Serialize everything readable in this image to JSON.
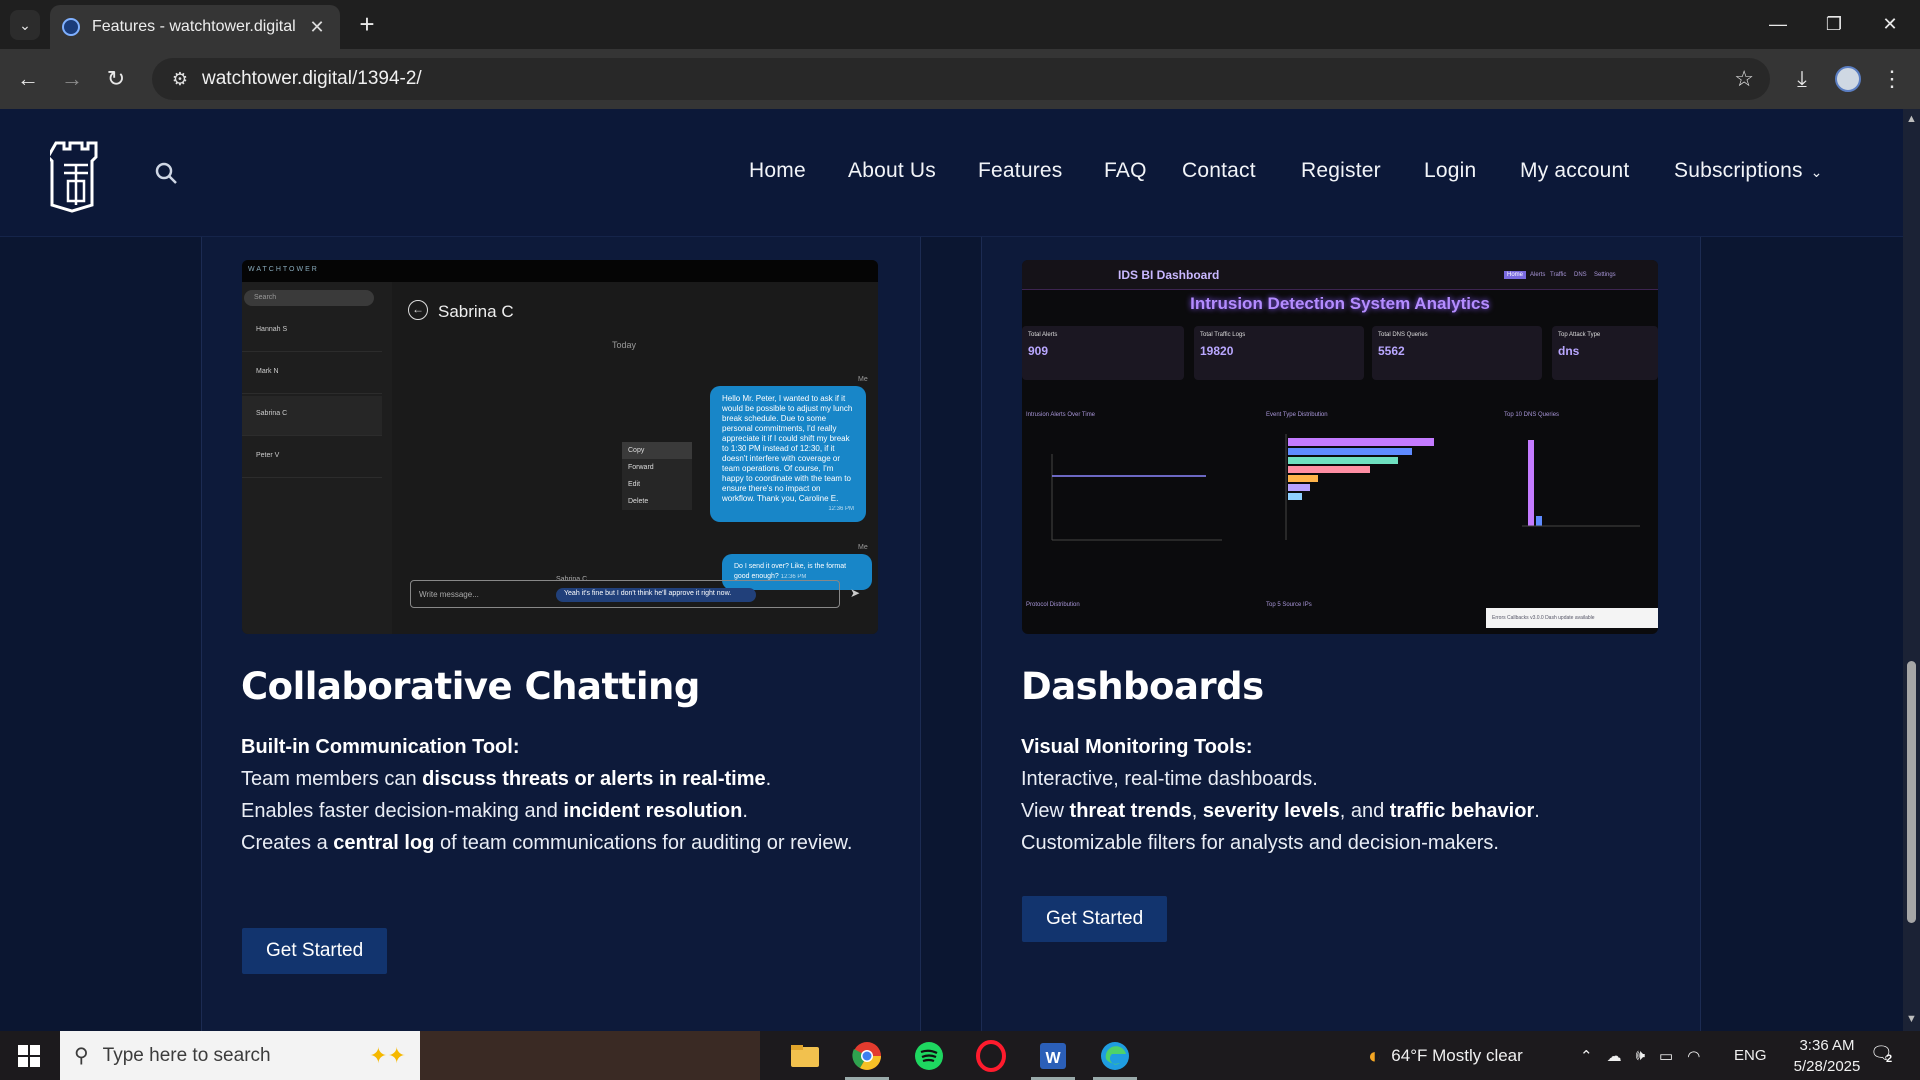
{
  "browser": {
    "tab_title": "Features - watchtower.digital",
    "url": "watchtower.digital/1394-2/"
  },
  "nav": {
    "items": [
      "Home",
      "About Us",
      "Features",
      "FAQ",
      "Contact",
      "Register",
      "Login",
      "My account",
      "Subscriptions"
    ]
  },
  "chat_shot": {
    "brand": "WATCHTOWER",
    "search": "Search",
    "contacts": [
      "Hannah S",
      "Mark N",
      "Sabrina C",
      "Peter V"
    ],
    "header": "Sabrina C",
    "today": "Today",
    "me_label": "Me",
    "message1": "Hello Mr. Peter, I wanted to ask if it would be possible to adjust my lunch break schedule. Due to some personal commitments, I'd really appreciate it if I could shift my break to 1:30 PM instead of 12:30, if it doesn't interfere with coverage or team operations. Of course, I'm happy to coordinate with the team to ensure there's no impact on workflow. Thank you, Caroline E.",
    "time1": "12:36 PM",
    "message2": "Do I send it over? Like, is the format good enough?",
    "time2": "12:36 PM",
    "them_label": "Sabrina C",
    "reply": "Yeah it's fine but I don't think he'll approve it right now.",
    "menu": [
      "Copy",
      "Forward",
      "Edit",
      "Delete"
    ],
    "input_placeholder": "Write message..."
  },
  "dash_shot": {
    "bar_title": "IDS BI Dashboard",
    "tabs": [
      "Home",
      "Alerts",
      "Traffic",
      "DNS",
      "Settings"
    ],
    "headline": "Intrusion Detection System Analytics",
    "kpis": [
      {
        "label": "Total Alerts",
        "value": "909"
      },
      {
        "label": "Total Traffic Logs",
        "value": "19820"
      },
      {
        "label": "Total DNS Queries",
        "value": "5562"
      },
      {
        "label": "Top Attack Type",
        "value": "dns"
      }
    ],
    "chart1": "Intrusion Alerts Over Time",
    "chart2": "Event Type Distribution",
    "chart3": "Top 10 DNS Queries",
    "chart4": "Protocol Distribution",
    "chart5": "Top 5 Source IPs",
    "footer": "Errors  Callbacks  v3.0.0  Dash update available"
  },
  "cards": [
    {
      "title": "Collaborative Chatting",
      "subtitle": "Built-in Communication Tool:",
      "l1a": "Team members can ",
      "l1b": "discuss threats or alerts in real-time",
      "l1c": ".",
      "l2a": "Enables faster decision-making and ",
      "l2b": "incident resolution",
      "l2c": ".",
      "l3a": "Creates a ",
      "l3b": "central log",
      "l3c": " of team communications for auditing or review.",
      "button": "Get Started"
    },
    {
      "title": "Dashboards",
      "subtitle": "Visual Monitoring Tools:",
      "l1": "Interactive, real-time dashboards.",
      "l2a": "View ",
      "l2b": "threat trends",
      "l2c": ", ",
      "l2d": "severity levels",
      "l2e": ", and ",
      "l2f": "traffic behavior",
      "l2g": ".",
      "l3": "Customizable filters for analysts and decision-makers.",
      "button": "Get Started"
    }
  ],
  "taskbar": {
    "search_placeholder": "Type here to search",
    "weather": "64°F  Mostly clear",
    "lang": "ENG",
    "time": "3:36 AM",
    "date": "5/28/2025",
    "notif_count": "2"
  }
}
